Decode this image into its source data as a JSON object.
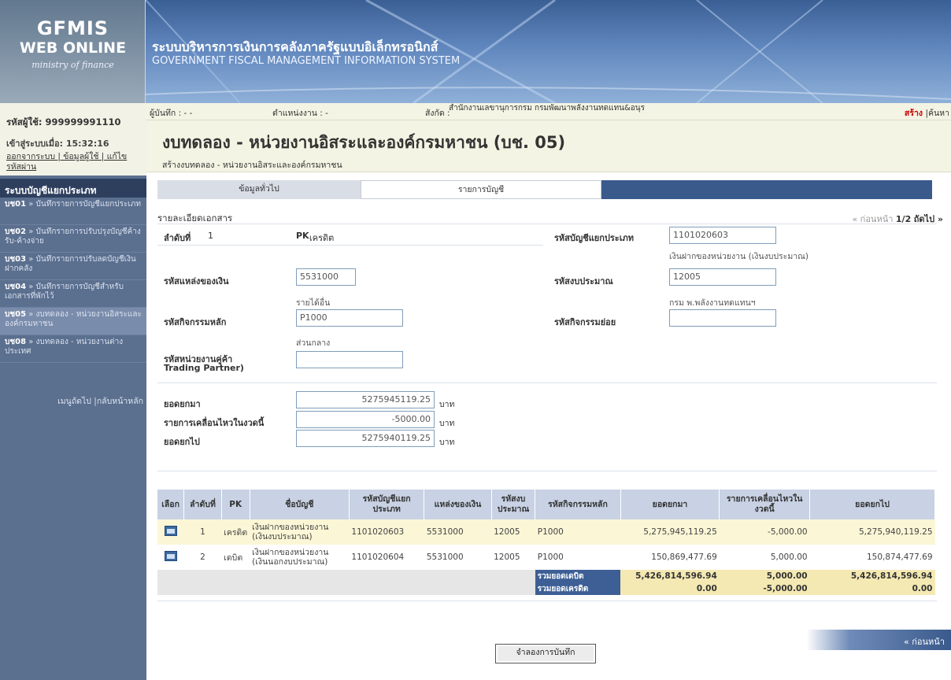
{
  "banner": {
    "logo_line1": "GFMIS",
    "logo_line2": "WEB ONLINE",
    "logo_line3": "ministry of finance",
    "title_th": "ระบบบริหารการเงินการคลังภาครัฐแบบอิเล็กทรอนิกส์",
    "title_en": "GOVERNMENT FISCAL MANAGEMENT INFORMATION SYSTEM"
  },
  "user": {
    "id": "รหัสผู้ใช้: 999999991110",
    "login_label": "เข้าสู่ระบบเมื่อ:",
    "login_time": "15:32:16",
    "links": "ออกจากระบบ | ข้อมูลผู้ใช้ | แก้ไขรหัสผ่าน"
  },
  "sidebar": {
    "title": "ระบบบัญชีแยกประเภท",
    "items": [
      {
        "code": "บช01",
        "label": "» บันทึกรายการบัญชีแยกประเภท"
      },
      {
        "code": "บช02",
        "label": "» บันทึกรายการปรับปรุงบัญชีค้างรับ-ค้างจ่าย"
      },
      {
        "code": "บช03",
        "label": "» บันทึกรายการปรับลดบัญชีเงินฝากคลัง"
      },
      {
        "code": "บช04",
        "label": "» บันทึกรายการบัญชีสำหรับเอกสารที่พักไว้"
      },
      {
        "code": "บช05",
        "label": "» งบทดลอง - หน่วยงานอิสระและองค์กรมหาชน"
      },
      {
        "code": "บช08",
        "label": "» งบทดลอง - หน่วยงานต่างประเทศ"
      }
    ],
    "footer": "เมนูถัดไป |กลับหน้าหลัก"
  },
  "infobar": {
    "recorder": "ผู้บันทึก : - -",
    "position": "ตำแหน่งงาน : -",
    "affiliation_label": "สังกัด :",
    "affiliation": "สำนักงานเลขานุการกรม กรมพัฒนาพลังงานทดแทน&อนุร",
    "create": "สร้าง",
    "search": "|ค้นหา"
  },
  "page": {
    "title": "งบทดลอง - หน่วยงานอิสระและองค์กรมหาชน (บช. 05)",
    "subtitle": "สร้างงบทดลอง - หน่วยงานอิสระและองค์กรมหาชน"
  },
  "tabs": [
    "ข้อมูลทั่วไป",
    "รายการบัญชี"
  ],
  "section": {
    "title": "รายละเอียดเอกสาร",
    "pager_prev": "« ก่อนหน้า",
    "pager_page": "1/2",
    "pager_next": "ถัดไป »"
  },
  "form": {
    "seq_label": "ลำดับที่",
    "seq_value": "1",
    "pk_label": "PK",
    "pk_value": "เครดิต",
    "gl_label": "รหัสบัญชีแยกประเภท",
    "gl_value": "1101020603",
    "gl_desc": "เงินฝากของหน่วยงาน (เงินงบประมาณ)",
    "fund_label": "รหัสแหล่งของเงิน",
    "fund_value": "5531000",
    "fund_desc": "รายได้อื่น",
    "budget_label": "รหัสงบประมาณ",
    "budget_value": "12005",
    "budget_desc": "กรม พ.พลังงานทดแทนฯ",
    "activity_label": "รหัสกิจกรรมหลัก",
    "activity_value": "P1000",
    "activity_desc": "ส่วนกลาง",
    "subactivity_label": "รหัสกิจกรรมย่อย",
    "subactivity_value": "",
    "tp_label1": "รหัสหน่วยงานคู่ค้า",
    "tp_label2": "Trading Partner)",
    "tp_value": "",
    "carry_in_label": "ยอดยกมา",
    "carry_in_value": "5275945119.25",
    "movement_label": "รายการเคลื่อนไหวในงวดนี้",
    "movement_value": "-5000.00",
    "carry_out_label": "ยอดยกไป",
    "carry_out_value": "5275940119.25",
    "unit": "บาท"
  },
  "table": {
    "headers": [
      "เลือก",
      "ลำดับที่",
      "PK",
      "ชื่อบัญชี",
      "รหัสบัญชีแยกประเภท",
      "แหล่งของเงิน",
      "รหัสงบประมาณ",
      "รหัสกิจกรรมหลัก",
      "ยอดยกมา",
      "รายการเคลื่อนไหวในงวดนี้",
      "ยอดยกไป"
    ],
    "rows": [
      {
        "seq": "1",
        "pk": "เครดิต",
        "name": "เงินฝากของหน่วยงาน (เงินงบประมาณ)",
        "gl": "1101020603",
        "fund": "5531000",
        "budget": "12005",
        "activity": "P1000",
        "carry_in": "5,275,945,119.25",
        "movement": "-5,000.00",
        "carry_out": "5,275,940,119.25"
      },
      {
        "seq": "2",
        "pk": "เดบิต",
        "name": "เงินฝากของหน่วยงาน (เงินนอกงบประมาณ)",
        "gl": "1101020604",
        "fund": "5531000",
        "budget": "12005",
        "activity": "P1000",
        "carry_in": "150,869,477.69",
        "movement": "5,000.00",
        "carry_out": "150,874,477.69"
      }
    ],
    "totals": [
      {
        "label": "รวมยอดเดบิต",
        "carry_in": "5,426,814,596.94",
        "movement": "5,000.00",
        "carry_out": "5,426,814,596.94"
      },
      {
        "label": "รวมยอดเครดิต",
        "carry_in": "0.00",
        "movement": "-5,000.00",
        "carry_out": "0.00"
      }
    ]
  },
  "buttons": {
    "back": "« ก่อนหน้า",
    "save": "จำลองการบันทึก"
  }
}
